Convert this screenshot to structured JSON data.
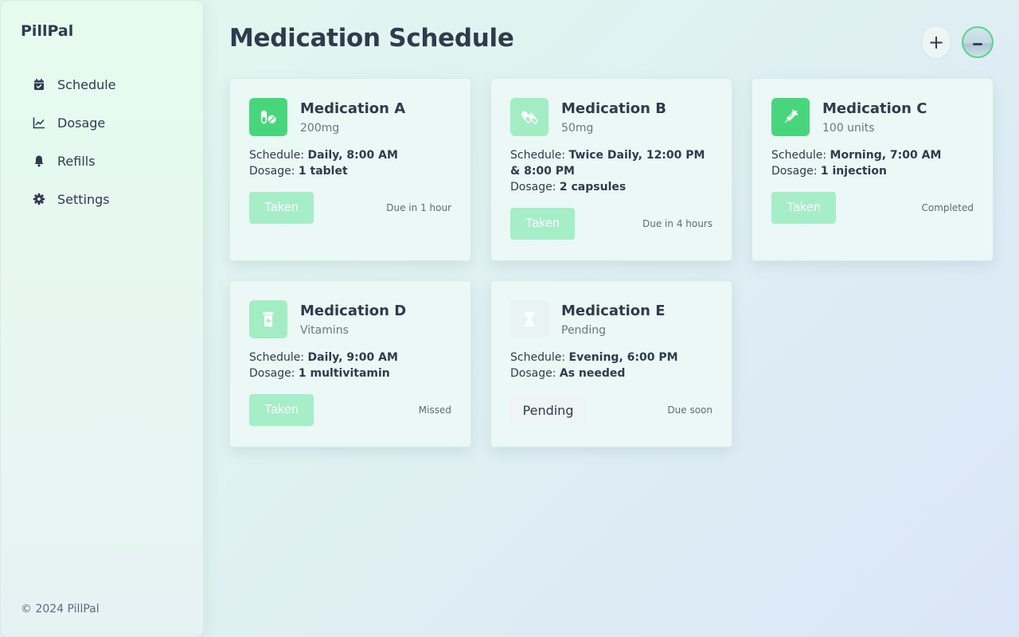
{
  "app": {
    "brand": "PillPal",
    "copyright": "© 2024 PillPal"
  },
  "sidebar": {
    "items": [
      {
        "label": "Schedule",
        "icon": "calendar-check-icon"
      },
      {
        "label": "Dosage",
        "icon": "chart-line-icon"
      },
      {
        "label": "Refills",
        "icon": "bell-icon"
      },
      {
        "label": "Settings",
        "icon": "gear-icon"
      }
    ]
  },
  "header": {
    "title": "Medication Schedule",
    "add_label": "+"
  },
  "labels": {
    "schedule": "Schedule:",
    "dosage": "Dosage:"
  },
  "colors": {
    "accent": "#48d67c",
    "accent_light": "#a3edc4",
    "text": "#2f3b4d"
  },
  "cards": [
    {
      "name": "Medication A",
      "sub": "200mg",
      "icon": "pills-icon",
      "schedule": "Daily, 8:00 AM",
      "dosage": "1 tablet",
      "action": "Taken",
      "status": "Due in 1 hour"
    },
    {
      "name": "Medication B",
      "sub": "50mg",
      "icon": "capsules-icon",
      "schedule": "Twice Daily, 12:00 PM & 8:00 PM",
      "dosage": "2 capsules",
      "action": "Taken",
      "status": "Due in 4 hours"
    },
    {
      "name": "Medication C",
      "sub": "100 units",
      "icon": "syringe-icon",
      "schedule": "Morning, 7:00 AM",
      "dosage": "1 injection",
      "action": "Taken",
      "status": "Completed"
    },
    {
      "name": "Medication D",
      "sub": "Vitamins",
      "icon": "prescription-bottle-icon",
      "schedule": "Daily, 9:00 AM",
      "dosage": "1 multivitamin",
      "action": "Taken",
      "status": "Missed"
    },
    {
      "name": "Medication E",
      "sub": "Pending",
      "icon": "hourglass-icon",
      "schedule": "Evening, 6:00 PM",
      "dosage": "As needed",
      "action": "Pending",
      "status": "Due soon"
    }
  ]
}
